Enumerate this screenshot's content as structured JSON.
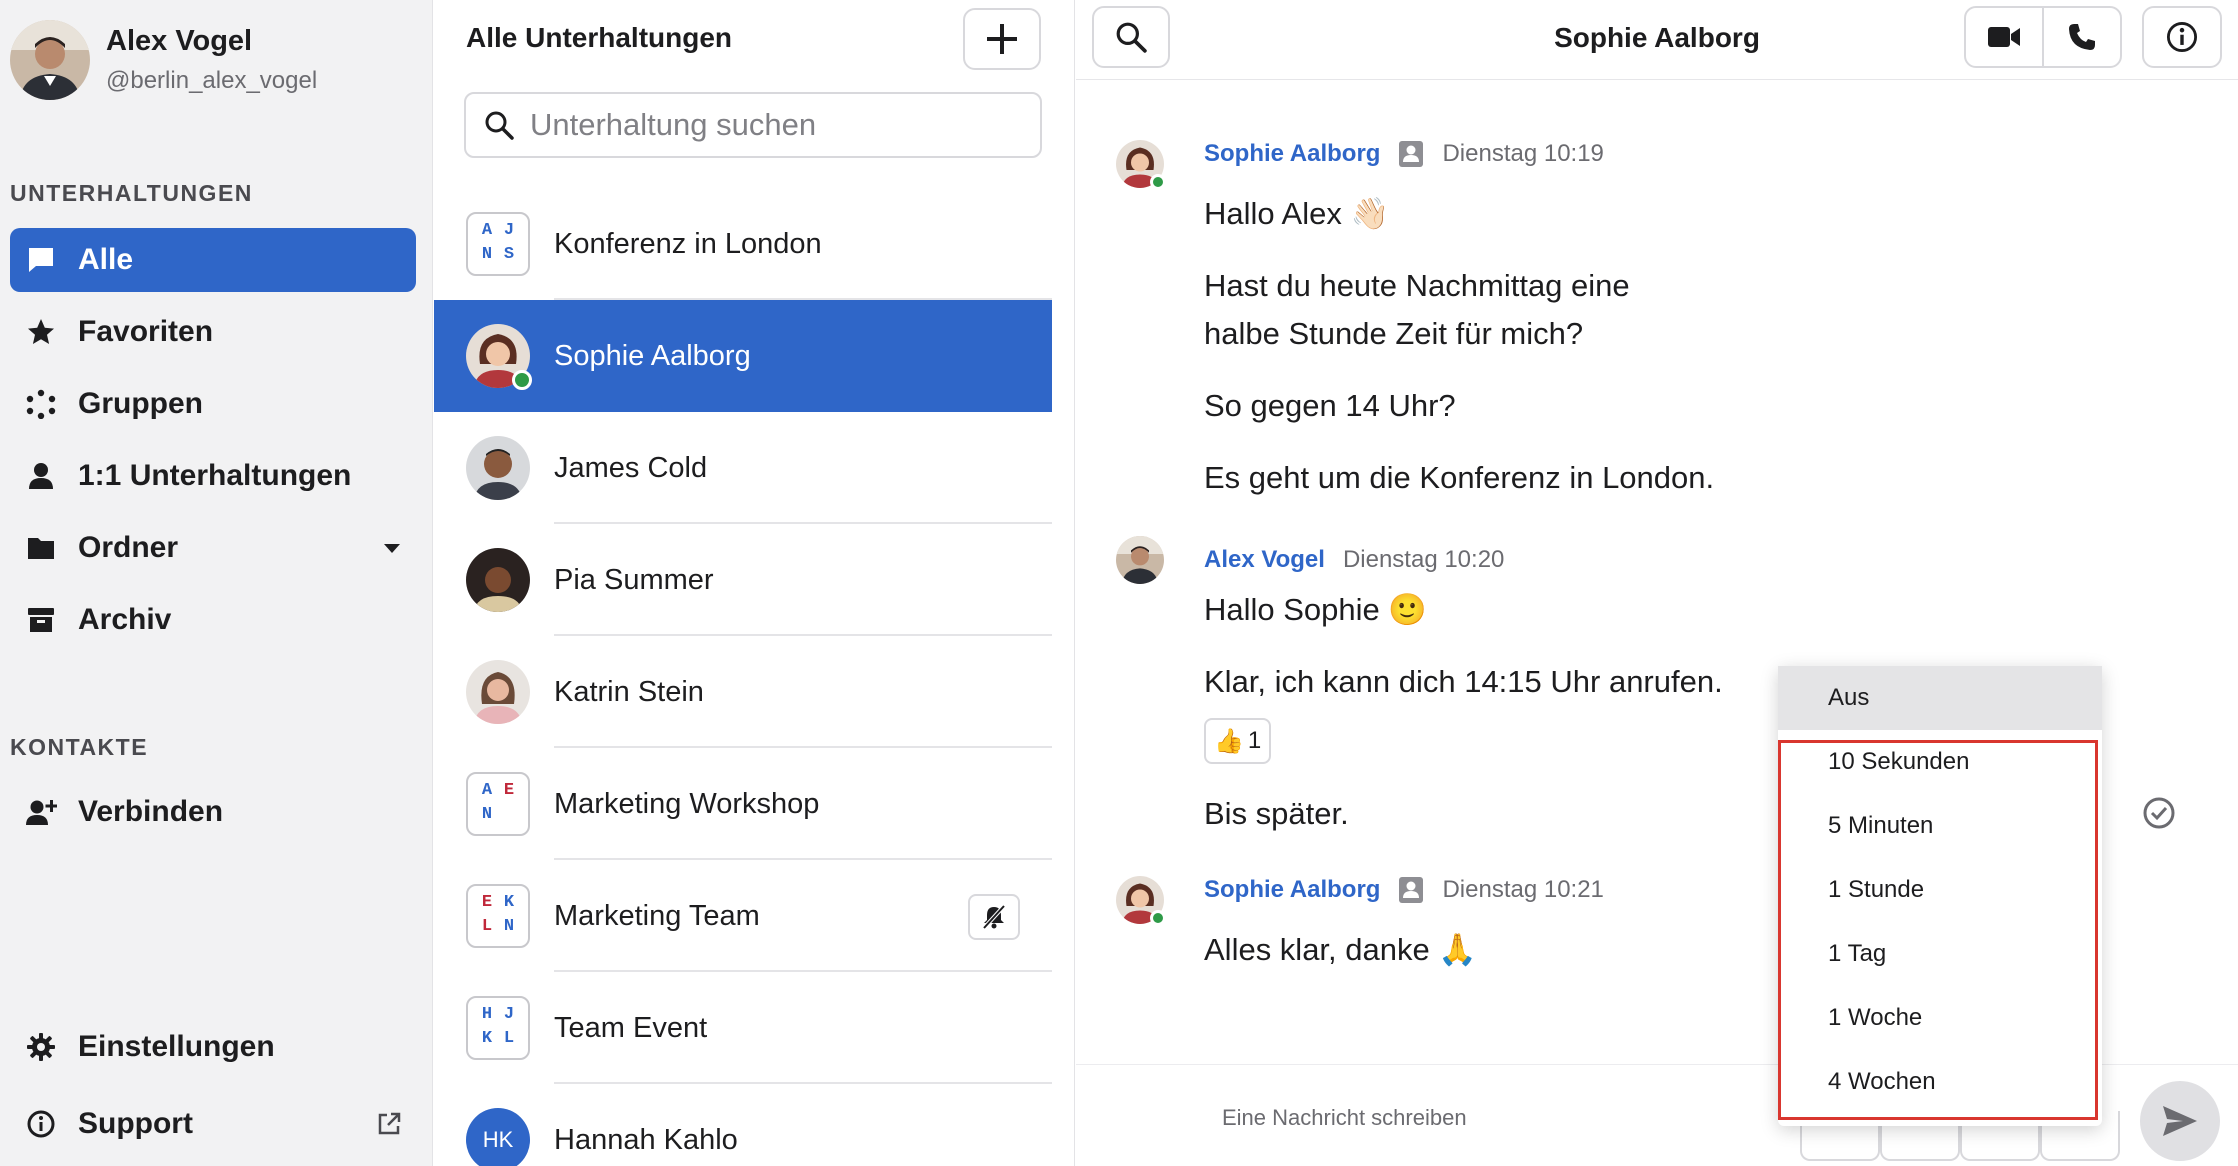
{
  "profile": {
    "name": "Alex Vogel",
    "handle": "@berlin_alex_vogel"
  },
  "sidebar": {
    "conversations_label": "UNTERHALTUNGEN",
    "items": [
      {
        "label": "Alle",
        "icon": "chat-bubble-icon",
        "active": true
      },
      {
        "label": "Favoriten",
        "icon": "star-icon"
      },
      {
        "label": "Gruppen",
        "icon": "group-dots-icon"
      },
      {
        "label": "1:1 Unterhaltungen",
        "icon": "person-icon"
      },
      {
        "label": "Ordner",
        "icon": "folder-icon"
      },
      {
        "label": "Archiv",
        "icon": "archive-icon"
      }
    ],
    "contacts_label": "KONTAKTE",
    "connect_label": "Verbinden",
    "settings_label": "Einstellungen",
    "support_label": "Support"
  },
  "convlist": {
    "title": "Alle Unterhaltungen",
    "search_placeholder": "Unterhaltung suchen",
    "items": [
      {
        "name": "Konferenz in London",
        "type": "group",
        "letters": [
          "A",
          "J",
          "N",
          "S"
        ]
      },
      {
        "name": "Sophie Aalborg",
        "type": "person",
        "active": true,
        "online": true
      },
      {
        "name": "James Cold",
        "type": "person"
      },
      {
        "name": "Pia Summer",
        "type": "person"
      },
      {
        "name": "Katrin Stein",
        "type": "person"
      },
      {
        "name": "Marketing Workshop",
        "type": "group",
        "letters": [
          "A",
          "E",
          "N",
          ""
        ]
      },
      {
        "name": "Marketing Team",
        "type": "group",
        "letters": [
          "E",
          "K",
          "L",
          "N"
        ],
        "muted": true
      },
      {
        "name": "Team Event",
        "type": "group",
        "letters": [
          "H",
          "J",
          "K",
          "L"
        ]
      },
      {
        "name": "Hannah Kahlo",
        "type": "initials",
        "initials": "HK"
      }
    ]
  },
  "chat": {
    "title": "Sophie Aalborg",
    "messages": [
      {
        "author": "Sophie Aalborg",
        "time": "Dienstag 10:19",
        "lines": [
          "Hallo Alex 👋🏻",
          "Hast du heute Nachmittag eine",
          "halbe Stunde Zeit für mich?",
          "So gegen 14 Uhr?",
          "Es geht um die Konferenz in London."
        ]
      },
      {
        "author": "Alex Vogel",
        "time": "Dienstag 10:20",
        "lines": [
          "Hallo Sophie 🙂",
          "Klar, ich kann dich 14:15 Uhr anrufen.",
          "Bis später."
        ],
        "reaction": {
          "emoji": "👍",
          "count": "1"
        }
      },
      {
        "author": "Sophie Aalborg",
        "time": "Dienstag 10:21",
        "lines": [
          "Alles klar, danke 🙏"
        ]
      }
    ],
    "composer_placeholder": "Eine Nachricht schreiben"
  },
  "timer_menu": {
    "options": [
      "Aus",
      "10 Sekunden",
      "5 Minuten",
      "1 Stunde",
      "1 Tag",
      "1 Woche",
      "4 Wochen"
    ],
    "selected": "Aus"
  },
  "colors": {
    "accent": "#2f66c8",
    "online": "#2e9a47",
    "highlight": "#d9362f"
  }
}
